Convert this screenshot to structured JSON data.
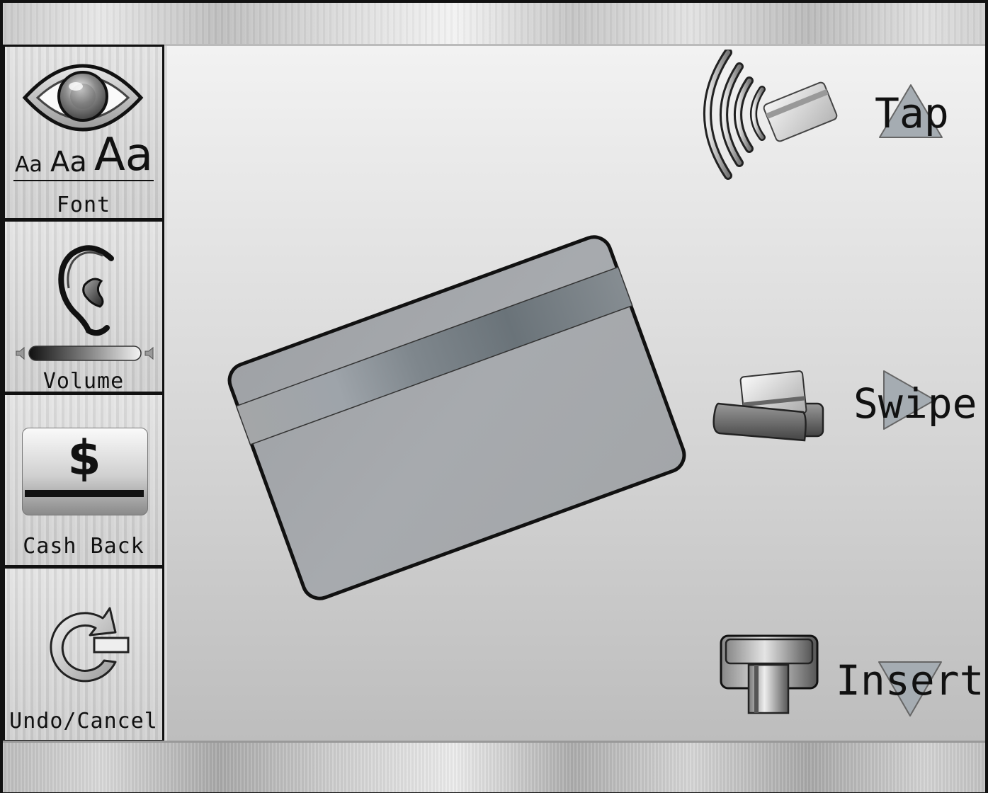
{
  "sidebar": {
    "font": {
      "sample_small": "Aa",
      "sample_medium": "Aa",
      "sample_large": "Aa",
      "label": "Font",
      "icon": "eye-icon"
    },
    "volume": {
      "label": "Volume",
      "icon": "ear-icon"
    },
    "cash_back": {
      "symbol": "$",
      "label": "Cash Back",
      "icon": "cash-icon"
    },
    "undo": {
      "label": "Undo/Cancel",
      "icon": "undo-icon"
    }
  },
  "actions": {
    "tap": {
      "label": "Tap",
      "icon": "contactless-icon"
    },
    "swipe": {
      "label": "Swipe",
      "icon": "card-swipe-icon"
    },
    "insert": {
      "label": "Insert",
      "icon": "card-insert-icon"
    }
  },
  "colors": {
    "frame": "#111111",
    "metal": "#c8c8c8",
    "card": "#a3a6aa",
    "stripe": "#6e767c"
  }
}
